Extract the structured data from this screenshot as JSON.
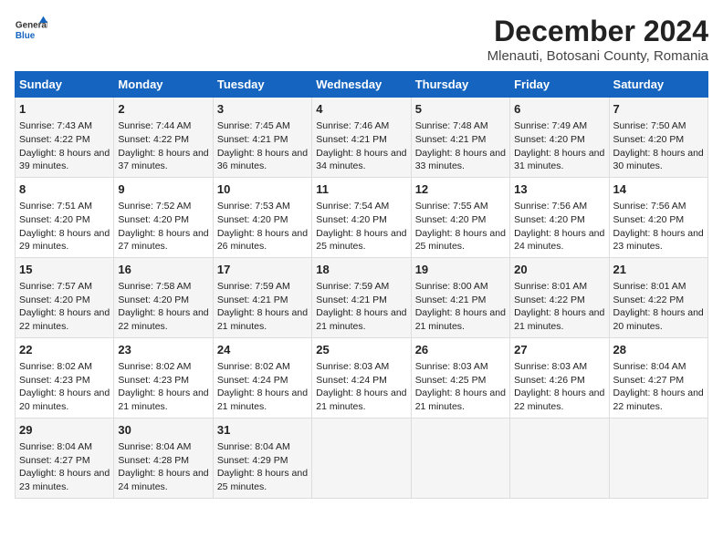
{
  "logo": {
    "line1": "General",
    "line2": "Blue"
  },
  "title": "December 2024",
  "subtitle": "Mlenauti, Botosani County, Romania",
  "days_of_week": [
    "Sunday",
    "Monday",
    "Tuesday",
    "Wednesday",
    "Thursday",
    "Friday",
    "Saturday"
  ],
  "weeks": [
    [
      {
        "day": 1,
        "sunrise": "7:43 AM",
        "sunset": "4:22 PM",
        "daylight": "8 hours and 39 minutes."
      },
      {
        "day": 2,
        "sunrise": "7:44 AM",
        "sunset": "4:22 PM",
        "daylight": "8 hours and 37 minutes."
      },
      {
        "day": 3,
        "sunrise": "7:45 AM",
        "sunset": "4:21 PM",
        "daylight": "8 hours and 36 minutes."
      },
      {
        "day": 4,
        "sunrise": "7:46 AM",
        "sunset": "4:21 PM",
        "daylight": "8 hours and 34 minutes."
      },
      {
        "day": 5,
        "sunrise": "7:48 AM",
        "sunset": "4:21 PM",
        "daylight": "8 hours and 33 minutes."
      },
      {
        "day": 6,
        "sunrise": "7:49 AM",
        "sunset": "4:20 PM",
        "daylight": "8 hours and 31 minutes."
      },
      {
        "day": 7,
        "sunrise": "7:50 AM",
        "sunset": "4:20 PM",
        "daylight": "8 hours and 30 minutes."
      }
    ],
    [
      {
        "day": 8,
        "sunrise": "7:51 AM",
        "sunset": "4:20 PM",
        "daylight": "8 hours and 29 minutes."
      },
      {
        "day": 9,
        "sunrise": "7:52 AM",
        "sunset": "4:20 PM",
        "daylight": "8 hours and 27 minutes."
      },
      {
        "day": 10,
        "sunrise": "7:53 AM",
        "sunset": "4:20 PM",
        "daylight": "8 hours and 26 minutes."
      },
      {
        "day": 11,
        "sunrise": "7:54 AM",
        "sunset": "4:20 PM",
        "daylight": "8 hours and 25 minutes."
      },
      {
        "day": 12,
        "sunrise": "7:55 AM",
        "sunset": "4:20 PM",
        "daylight": "8 hours and 25 minutes."
      },
      {
        "day": 13,
        "sunrise": "7:56 AM",
        "sunset": "4:20 PM",
        "daylight": "8 hours and 24 minutes."
      },
      {
        "day": 14,
        "sunrise": "7:56 AM",
        "sunset": "4:20 PM",
        "daylight": "8 hours and 23 minutes."
      }
    ],
    [
      {
        "day": 15,
        "sunrise": "7:57 AM",
        "sunset": "4:20 PM",
        "daylight": "8 hours and 22 minutes."
      },
      {
        "day": 16,
        "sunrise": "7:58 AM",
        "sunset": "4:20 PM",
        "daylight": "8 hours and 22 minutes."
      },
      {
        "day": 17,
        "sunrise": "7:59 AM",
        "sunset": "4:21 PM",
        "daylight": "8 hours and 21 minutes."
      },
      {
        "day": 18,
        "sunrise": "7:59 AM",
        "sunset": "4:21 PM",
        "daylight": "8 hours and 21 minutes."
      },
      {
        "day": 19,
        "sunrise": "8:00 AM",
        "sunset": "4:21 PM",
        "daylight": "8 hours and 21 minutes."
      },
      {
        "day": 20,
        "sunrise": "8:01 AM",
        "sunset": "4:22 PM",
        "daylight": "8 hours and 21 minutes."
      },
      {
        "day": 21,
        "sunrise": "8:01 AM",
        "sunset": "4:22 PM",
        "daylight": "8 hours and 20 minutes."
      }
    ],
    [
      {
        "day": 22,
        "sunrise": "8:02 AM",
        "sunset": "4:23 PM",
        "daylight": "8 hours and 20 minutes."
      },
      {
        "day": 23,
        "sunrise": "8:02 AM",
        "sunset": "4:23 PM",
        "daylight": "8 hours and 21 minutes."
      },
      {
        "day": 24,
        "sunrise": "8:02 AM",
        "sunset": "4:24 PM",
        "daylight": "8 hours and 21 minutes."
      },
      {
        "day": 25,
        "sunrise": "8:03 AM",
        "sunset": "4:24 PM",
        "daylight": "8 hours and 21 minutes."
      },
      {
        "day": 26,
        "sunrise": "8:03 AM",
        "sunset": "4:25 PM",
        "daylight": "8 hours and 21 minutes."
      },
      {
        "day": 27,
        "sunrise": "8:03 AM",
        "sunset": "4:26 PM",
        "daylight": "8 hours and 22 minutes."
      },
      {
        "day": 28,
        "sunrise": "8:04 AM",
        "sunset": "4:27 PM",
        "daylight": "8 hours and 22 minutes."
      }
    ],
    [
      {
        "day": 29,
        "sunrise": "8:04 AM",
        "sunset": "4:27 PM",
        "daylight": "8 hours and 23 minutes."
      },
      {
        "day": 30,
        "sunrise": "8:04 AM",
        "sunset": "4:28 PM",
        "daylight": "8 hours and 24 minutes."
      },
      {
        "day": 31,
        "sunrise": "8:04 AM",
        "sunset": "4:29 PM",
        "daylight": "8 hours and 25 minutes."
      },
      null,
      null,
      null,
      null
    ]
  ]
}
